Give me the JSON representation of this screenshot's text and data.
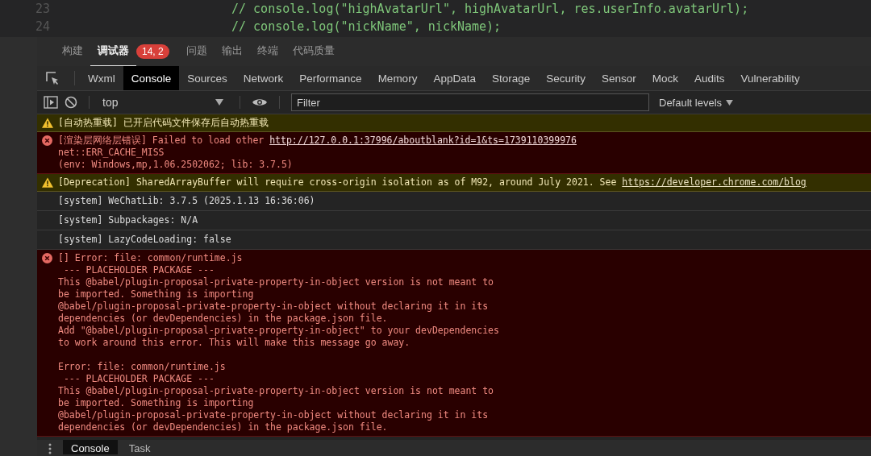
{
  "editor": {
    "lines": [
      {
        "number": "23",
        "code": "// console.log(\"highAvatarUrl\", highAvatarUrl, res.userInfo.avatarUrl);"
      },
      {
        "number": "24",
        "code": "// console.log(\"nickName\", nickName);"
      }
    ]
  },
  "panel_tabs": [
    {
      "label": "构建",
      "selected": false
    },
    {
      "label": "调试器",
      "selected": true,
      "badge": "14, 2"
    },
    {
      "label": "问题",
      "selected": false
    },
    {
      "label": "输出",
      "selected": false
    },
    {
      "label": "终端",
      "selected": false
    },
    {
      "label": "代码质量",
      "selected": false
    }
  ],
  "devtools_tabs": [
    {
      "label": "Wxml",
      "selected": false
    },
    {
      "label": "Console",
      "selected": true
    },
    {
      "label": "Sources",
      "selected": false
    },
    {
      "label": "Network",
      "selected": false
    },
    {
      "label": "Performance",
      "selected": false
    },
    {
      "label": "Memory",
      "selected": false
    },
    {
      "label": "AppData",
      "selected": false
    },
    {
      "label": "Storage",
      "selected": false
    },
    {
      "label": "Security",
      "selected": false
    },
    {
      "label": "Sensor",
      "selected": false
    },
    {
      "label": "Mock",
      "selected": false
    },
    {
      "label": "Audits",
      "selected": false
    },
    {
      "label": "Vulnerability",
      "selected": false
    }
  ],
  "toolbar": {
    "context": "top",
    "filter": {
      "placeholder": "Filter"
    },
    "levels": "Default levels"
  },
  "messages": [
    {
      "kind": "warning",
      "lines": [
        "[自动热重载] 已开启代码文件保存后自动热重载"
      ]
    },
    {
      "kind": "error",
      "lines": [
        "[渲染层网络层错误] Failed to load other ",
        "net::ERR_CACHE_MISS",
        "(env: Windows,mp,1.06.2502062; lib: 3.7.5)"
      ],
      "link": "http://127.0.0.1:37996/aboutblank?id=1&ts=1739110399976"
    },
    {
      "kind": "warning",
      "lines": [
        "[Deprecation] SharedArrayBuffer will require cross-origin isolation as of M92, around July 2021. See "
      ],
      "link": "https://developer.chrome.com/blog"
    },
    {
      "kind": "log",
      "lines": [
        "[system] WeChatLib: 3.7.5 (2025.1.13 16:36:06)"
      ]
    },
    {
      "kind": "log",
      "lines": [
        "[system] Subpackages: N/A"
      ]
    },
    {
      "kind": "log",
      "lines": [
        "[system] LazyCodeLoading: false"
      ]
    },
    {
      "kind": "error",
      "lines": [
        "[] Error: file: common/runtime.js",
        " --- PLACEHOLDER PACKAGE ---",
        "This @babel/plugin-proposal-private-property-in-object version is not meant to",
        "be imported. Something is importing",
        "@babel/plugin-proposal-private-property-in-object without declaring it in its",
        "dependencies (or devDependencies) in the package.json file.",
        "Add \"@babel/plugin-proposal-private-property-in-object\" to your devDependencies",
        "to work around this error. This will make this message go away."
      ],
      "more_lines": [
        "Error: file: common/runtime.js",
        " --- PLACEHOLDER PACKAGE ---",
        "This @babel/plugin-proposal-private-property-in-object version is not meant to",
        "be imported. Something is importing",
        "@babel/plugin-proposal-private-property-in-object without declaring it in its",
        "dependencies (or devDependencies) in the package.json file."
      ]
    }
  ],
  "bottom_tabs": [
    {
      "label": "Console",
      "selected": true
    },
    {
      "label": "Task",
      "selected": false
    }
  ]
}
